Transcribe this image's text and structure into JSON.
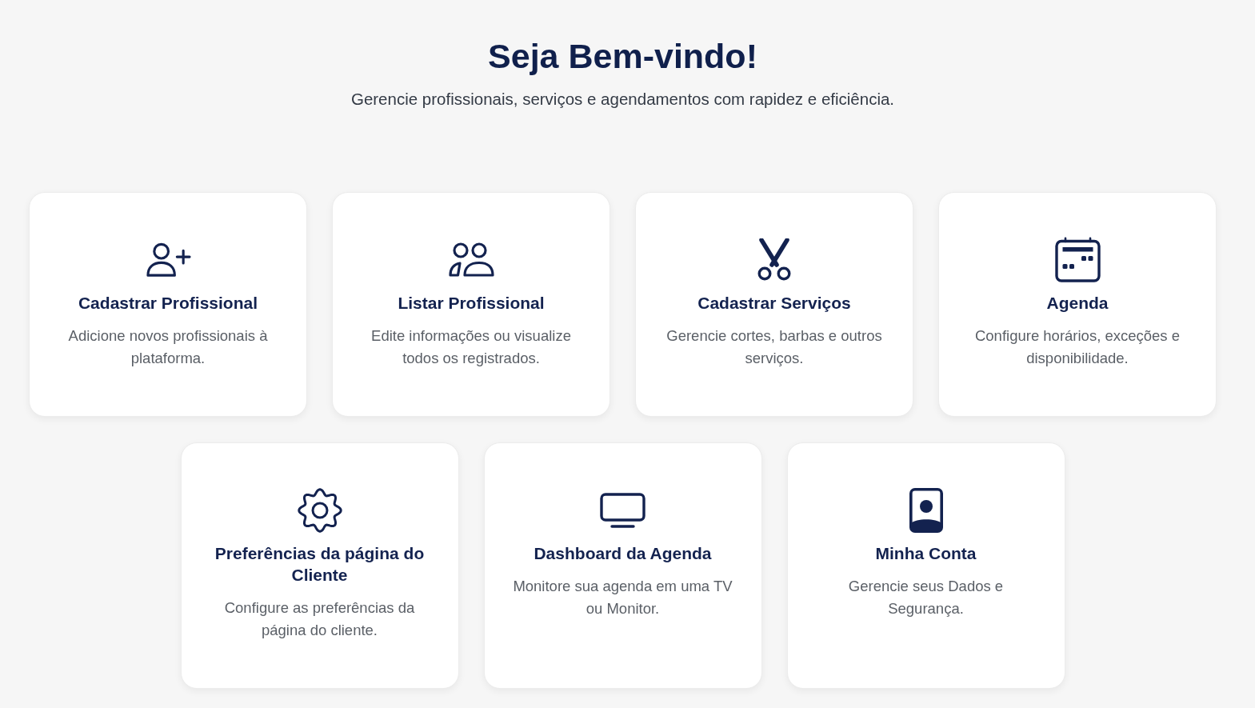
{
  "header": {
    "title": "Seja Bem-vindo!",
    "subtitle": "Gerencie profissionais, serviços e agendamentos com rapidez e eficiência."
  },
  "cards": [
    {
      "title": "Cadastrar Profissional",
      "description": "Adicione novos profissionais à plataforma."
    },
    {
      "title": "Listar Profissional",
      "description": "Edite informações ou visualize todos os registrados."
    },
    {
      "title": "Cadastrar Serviços",
      "description": "Gerencie cortes, barbas e outros serviços."
    },
    {
      "title": "Agenda",
      "description": "Configure horários, exceções e disponibilidade."
    },
    {
      "title": "Preferências da página do Cliente",
      "description": "Configure as preferências da página do cliente."
    },
    {
      "title": "Dashboard da Agenda",
      "description": "Monitore sua agenda em uma TV ou Monitor."
    },
    {
      "title": "Minha Conta",
      "description": "Gerencie seus Dados e Segurança."
    }
  ]
}
